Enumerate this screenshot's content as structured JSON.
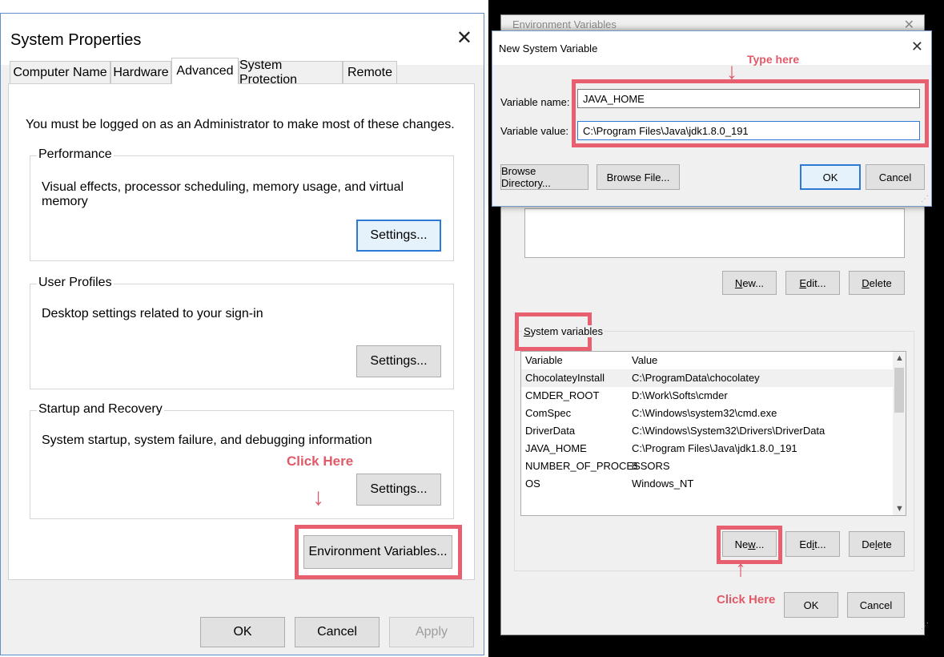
{
  "system_properties": {
    "title": "System Properties",
    "close_glyph": "✕",
    "tabs": [
      "Computer Name",
      "Hardware",
      "Advanced",
      "System Protection",
      "Remote"
    ],
    "active_tab": "Advanced",
    "admin_note": "You must be logged on as an Administrator to make most of these changes.",
    "performance": {
      "label": "Performance",
      "description": "Visual effects, processor scheduling, memory usage, and virtual memory",
      "settings_label": "Settings..."
    },
    "user_profiles": {
      "label": "User Profiles",
      "description": "Desktop settings related to your sign-in",
      "settings_label": "Settings..."
    },
    "startup_recovery": {
      "label": "Startup and Recovery",
      "description": "System startup, system failure, and debugging information",
      "settings_label": "Settings..."
    },
    "env_vars_label": "Environment Variables...",
    "ok_label": "OK",
    "cancel_label": "Cancel",
    "apply_label": "Apply"
  },
  "annotations": {
    "click_here_left": "Click Here",
    "arrow_down": "↓",
    "type_here": "Type here",
    "click_here_right": "Click Here",
    "arrow_up": "↑"
  },
  "environment_variables": {
    "title": "Environment Variables",
    "close_glyph": "✕",
    "user_buttons": {
      "new_pre": "",
      "new_key": "N",
      "new_post": "ew...",
      "edit_pre": "",
      "edit_key": "E",
      "edit_post": "dit...",
      "delete_pre": "",
      "delete_key": "D",
      "delete_post": "elete"
    },
    "system_variables_label_key": "S",
    "system_variables_label_rest": "ystem variables",
    "table": {
      "headers": [
        "Variable",
        "Value"
      ],
      "rows": [
        {
          "variable": "ChocolateyInstall",
          "value": "C:\\ProgramData\\chocolatey"
        },
        {
          "variable": "CMDER_ROOT",
          "value": "D:\\Work\\Softs\\cmder"
        },
        {
          "variable": "ComSpec",
          "value": "C:\\Windows\\system32\\cmd.exe"
        },
        {
          "variable": "DriverData",
          "value": "C:\\Windows\\System32\\Drivers\\DriverData"
        },
        {
          "variable": "JAVA_HOME",
          "value": "C:\\Program Files\\Java\\jdk1.8.0_191"
        },
        {
          "variable": "NUMBER_OF_PROCESSORS",
          "value": "8"
        },
        {
          "variable": "OS",
          "value": "Windows_NT"
        }
      ]
    },
    "system_buttons": {
      "new_pre": "Ne",
      "new_key": "w",
      "new_post": "...",
      "edit_pre": "Ed",
      "edit_key": "i",
      "edit_post": "t...",
      "delete_pre": "De",
      "delete_key": "l",
      "delete_post": "ete"
    },
    "ok_label": "OK",
    "cancel_label": "Cancel"
  },
  "new_system_variable": {
    "title": "New System Variable",
    "close_glyph": "✕",
    "name_label": "Variable name:",
    "name_value": "JAVA_HOME",
    "value_label": "Variable value:",
    "value_value": "C:\\Program Files\\Java\\jdk1.8.0_191",
    "browse_directory_label": "Browse Directory...",
    "browse_file_label": "Browse File...",
    "ok_label": "OK",
    "cancel_label": "Cancel"
  },
  "colors": {
    "annotation_red": "#e8606f",
    "focus_blue": "#2a7ad6",
    "dialog_bg": "#f0f0f0"
  }
}
